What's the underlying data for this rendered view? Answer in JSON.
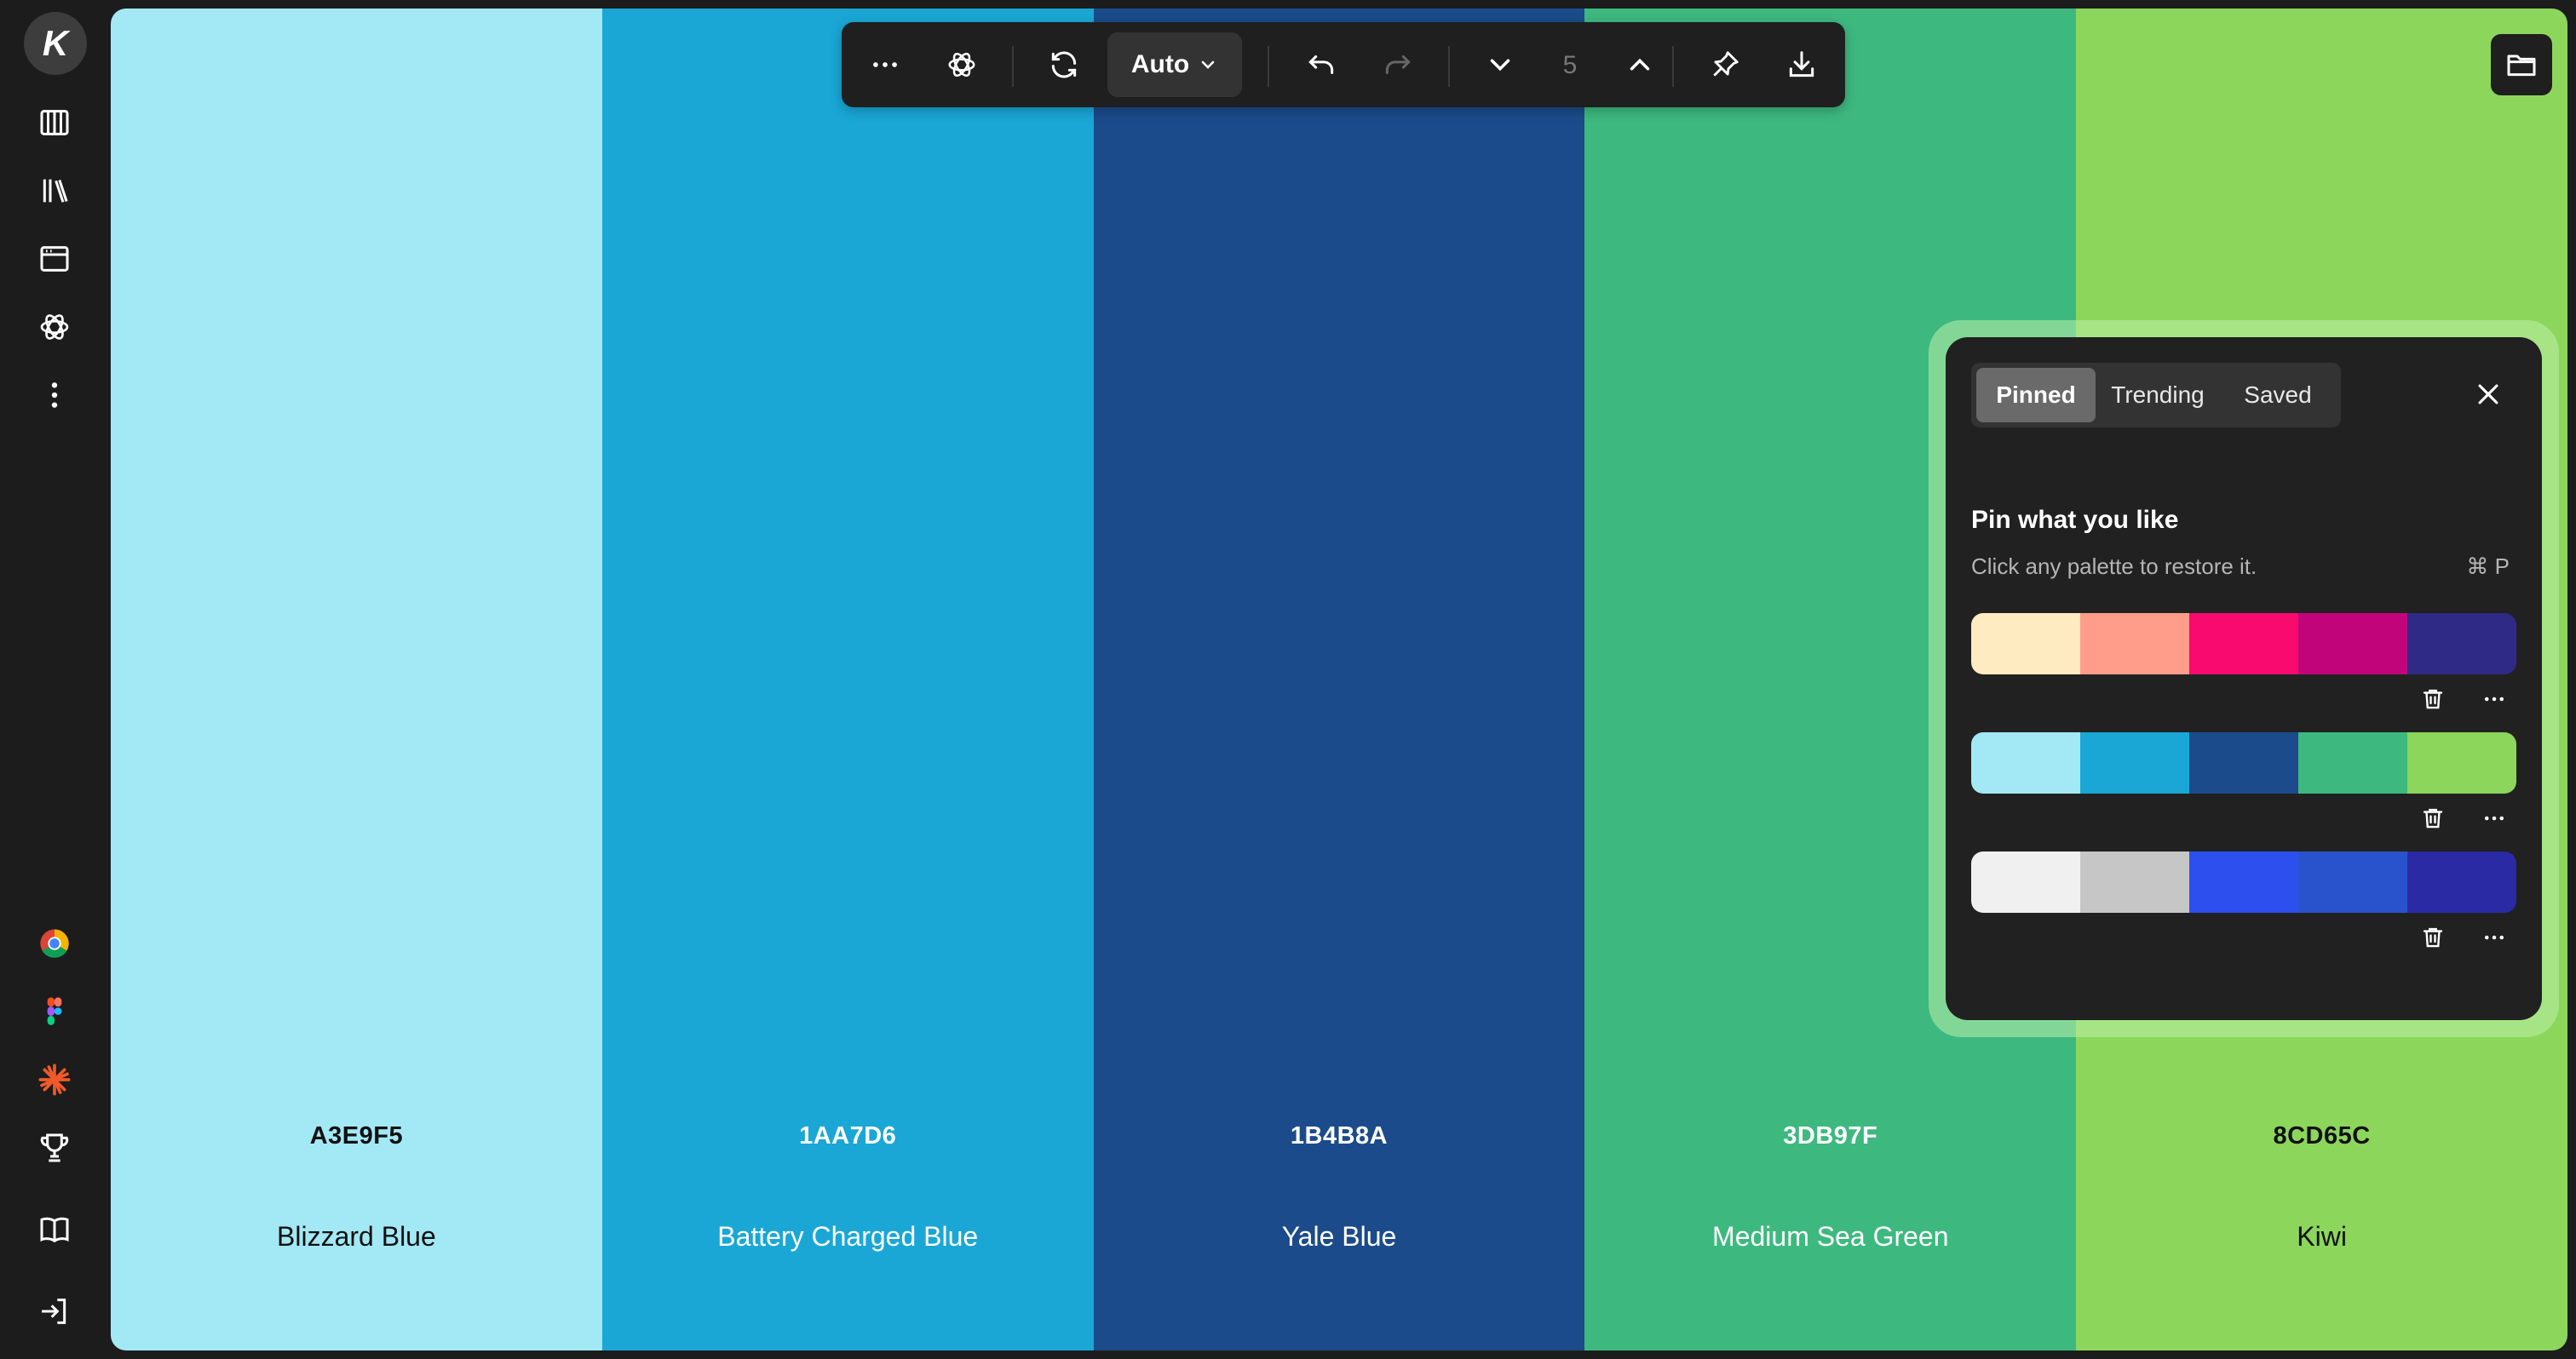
{
  "sidebar": {
    "logo_letter": "K",
    "top_icons": [
      "columns-icon",
      "library-icon",
      "browser-window-icon",
      "openai-icon",
      "more-vertical-icon"
    ],
    "bottom_icons": [
      "chrome-icon",
      "figma-icon",
      "burst-icon",
      "trophy-icon",
      "book-icon",
      "sign-in-icon"
    ]
  },
  "toolbar": {
    "auto_label": "Auto",
    "count": "5",
    "icons": [
      "more-horizontal-icon",
      "openai-icon",
      "refresh-icon",
      "chevron-down-icon",
      "undo-icon",
      "redo-icon",
      "arrow-down-icon",
      "arrow-up-icon",
      "pin-icon",
      "download-icon"
    ]
  },
  "swatches": [
    {
      "hex": "A3E9F5",
      "name": "Blizzard Blue",
      "color": "#A3E9F5",
      "text_color": "#111111"
    },
    {
      "hex": "1AA7D6",
      "name": "Battery Charged Blue",
      "color": "#1AA7D6",
      "text_color": "#FFFFFF"
    },
    {
      "hex": "1B4B8A",
      "name": "Yale Blue",
      "color": "#1B4B8A",
      "text_color": "#FFFFFF"
    },
    {
      "hex": "3DB97F",
      "name": "Medium Sea Green",
      "color": "#3DB97F",
      "text_color": "#FFFFFF"
    },
    {
      "hex": "8CD65C",
      "name": "Kiwi",
      "color": "#8CD65C",
      "text_color": "#111111"
    }
  ],
  "panel": {
    "tabs": [
      {
        "label": "Pinned",
        "active": true
      },
      {
        "label": "Trending",
        "active": false
      },
      {
        "label": "Saved",
        "active": false
      }
    ],
    "title": "Pin what you like",
    "subtitle": "Click any palette to restore it.",
    "shortcut": "⌘ P",
    "palettes": [
      [
        "#FFEBC2",
        "#FF9C8A",
        "#F80A6E",
        "#C2047A",
        "#2F2A86"
      ],
      [
        "#A3E9F5",
        "#1AA7D6",
        "#1B4B8A",
        "#3DB97F",
        "#8CD65C"
      ],
      [
        "#F0F0F0",
        "#C6C6C6",
        "#2C4FEE",
        "#2953CC",
        "#2B2AA5"
      ]
    ]
  }
}
